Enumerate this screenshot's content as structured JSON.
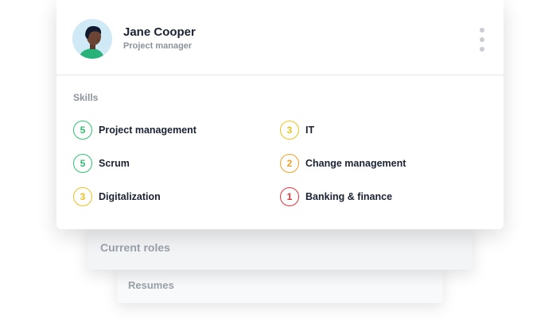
{
  "profile": {
    "name": "Jane Cooper",
    "role": "Project manager"
  },
  "skills": {
    "title": "Skills",
    "items": [
      {
        "level": "5",
        "label": "Project management",
        "color": "#2fbf71"
      },
      {
        "level": "3",
        "label": "IT",
        "color": "#e8c21f"
      },
      {
        "level": "5",
        "label": "Scrum",
        "color": "#2fbf71"
      },
      {
        "level": "2",
        "label": "Change management",
        "color": "#f0a024"
      },
      {
        "level": "3",
        "label": "Digitalization",
        "color": "#e8c21f"
      },
      {
        "level": "1",
        "label": "Banking & finance",
        "color": "#e0323a"
      }
    ]
  },
  "stacked_cards": {
    "current_roles": "Current roles",
    "resumes": "Resumes"
  },
  "icons": {
    "menu": "kebab-menu-icon",
    "avatar": "person-avatar"
  }
}
